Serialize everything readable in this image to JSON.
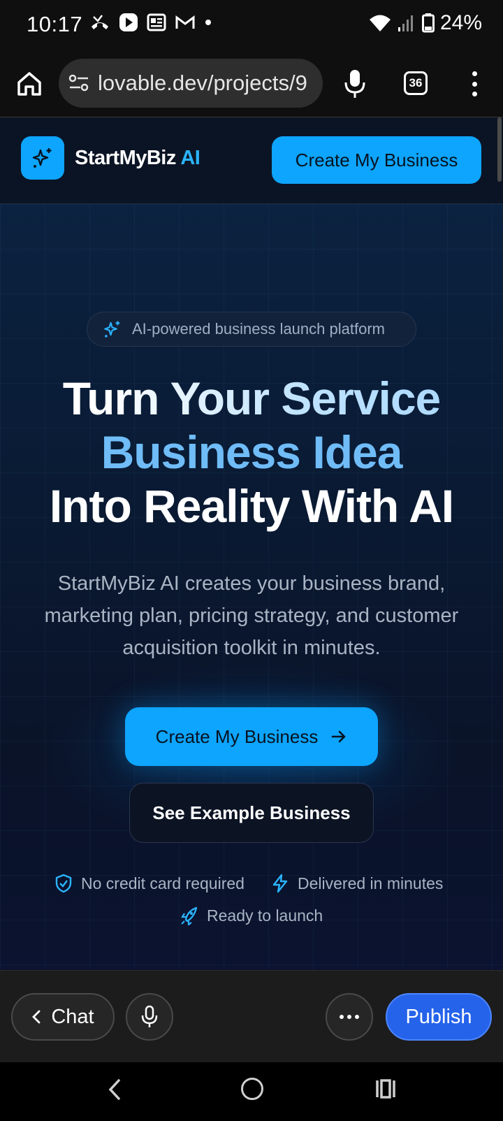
{
  "status_bar": {
    "time": "10:17",
    "battery": "24%",
    "icons_left": [
      "missed-call-icon",
      "play-icon",
      "news-icon",
      "gmail-icon",
      "dot-icon"
    ],
    "icons_right": [
      "wifi-icon",
      "signal-icon",
      "battery-icon"
    ]
  },
  "browser": {
    "url": "lovable.dev/projects/9",
    "tab_count": "36"
  },
  "site": {
    "brand": "StartMyBiz",
    "brand_accent": "AI",
    "header_cta": "Create My Business",
    "chip": "AI-powered business launch platform",
    "headline_line1": "Turn Your Service",
    "headline_line2": "Business Idea",
    "headline_line3": "Into Reality With AI",
    "subtext": "StartMyBiz AI creates your business brand, marketing plan, pricing strategy, and customer acquisition toolkit in minutes.",
    "cta_primary": "Create My Business",
    "cta_secondary": "See Example Business",
    "features": [
      {
        "label": "No credit card required",
        "icon": "shield-check-icon"
      },
      {
        "label": "Delivered in minutes",
        "icon": "lightning-icon"
      },
      {
        "label": "Ready to launch",
        "icon": "rocket-icon"
      }
    ]
  },
  "app_bar": {
    "chat_label": "Chat",
    "publish_label": "Publish"
  },
  "colors": {
    "accent": "#0ea5ff",
    "publish": "#2563eb",
    "headline_blue": "#6fbcf7"
  }
}
